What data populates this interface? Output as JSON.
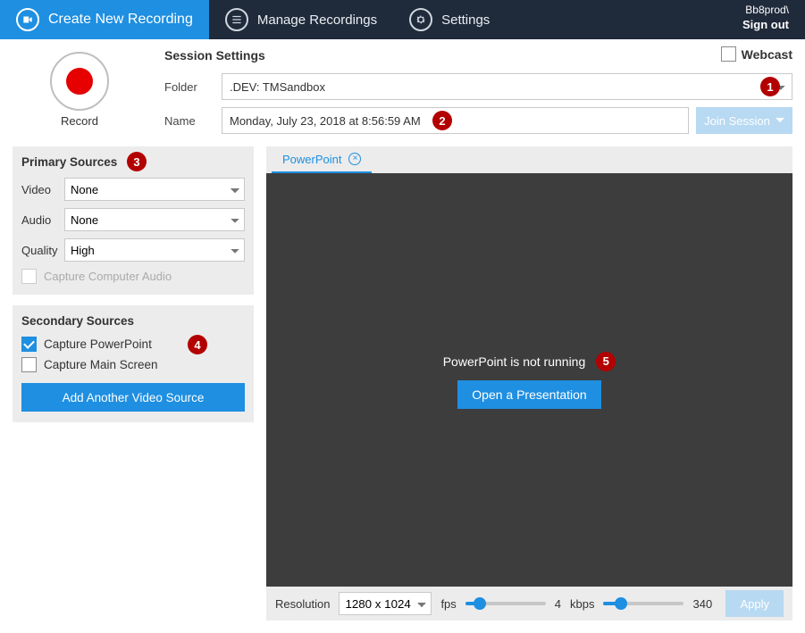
{
  "topbar": {
    "create": "Create New Recording",
    "manage": "Manage Recordings",
    "settings": "Settings",
    "user": "Bb8prod\\",
    "signout": "Sign out"
  },
  "session": {
    "title": "Session Settings",
    "record_label": "Record",
    "folder_label": "Folder",
    "folder_value": ".DEV: TMSandbox",
    "name_label": "Name",
    "name_value": "Monday, July 23, 2018 at 8:56:59 AM",
    "join": "Join Session",
    "webcast": "Webcast"
  },
  "primary": {
    "title": "Primary Sources",
    "video_label": "Video",
    "video_value": "None",
    "audio_label": "Audio",
    "audio_value": "None",
    "quality_label": "Quality",
    "quality_value": "High",
    "capture_audio": "Capture Computer Audio"
  },
  "secondary": {
    "title": "Secondary Sources",
    "ppt": "Capture PowerPoint",
    "screen": "Capture Main Screen",
    "add": "Add Another Video Source"
  },
  "preview": {
    "tab": "PowerPoint",
    "message": "PowerPoint is not running",
    "open": "Open a Presentation"
  },
  "footer": {
    "res_label": "Resolution",
    "res_value": "1280 x 1024",
    "fps_label": "fps",
    "fps_value": "4",
    "kbps_label": "kbps",
    "kbps_value": "340",
    "apply": "Apply"
  },
  "badges": {
    "b1": "1",
    "b2": "2",
    "b3": "3",
    "b4": "4",
    "b5": "5"
  }
}
